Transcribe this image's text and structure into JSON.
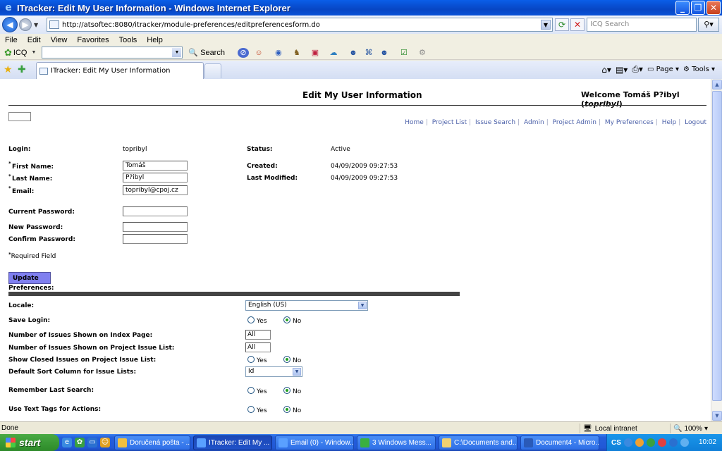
{
  "window": {
    "title": "ITracker: Edit My User Information - Windows Internet Explorer"
  },
  "address": {
    "url": "http://atsoftec:8080/itracker/module-preferences/editpreferencesform.do",
    "search_placeholder": "ICQ Search"
  },
  "menu": [
    "File",
    "Edit",
    "View",
    "Favorites",
    "Tools",
    "Help"
  ],
  "toolbar": {
    "icq_label": "ICQ",
    "search_label": "Search"
  },
  "tab": {
    "label": "ITracker: Edit My User Information"
  },
  "commandbar": {
    "page_label": "Page",
    "tools_label": "Tools"
  },
  "page": {
    "heading": "Edit My User Information",
    "welcome_prefix": "Welcome Tomáš P?ibyl (",
    "welcome_user": "topribyl",
    "welcome_suffix": ")",
    "nav": [
      "Home",
      "Project List",
      "Issue Search",
      "Admin",
      "Project Admin",
      "My Preferences",
      "Help",
      "Logout"
    ],
    "login_label": "Login:",
    "login_value": "topribyl",
    "status_label": "Status:",
    "status_value": "Active",
    "first_name_label": "First Name:",
    "first_name_value": "Tomáš",
    "last_name_label": "Last Name:",
    "last_name_value": "P?ibyl",
    "email_label": "Email:",
    "email_value": "topribyl@cpoj.cz",
    "created_label": "Created:",
    "created_value": "04/09/2009 09:27:53",
    "modified_label": "Last Modified:",
    "modified_value": "04/09/2009 09:27:53",
    "current_password_label": "Current Password:",
    "new_password_label": "New Password:",
    "confirm_password_label": "Confirm Password:",
    "required_note": "Required Field",
    "required_mark": "*",
    "update_label": "Update",
    "preferences_title": "Preferences:"
  },
  "prefs": {
    "locale_label": "Locale:",
    "locale_value": "English (US)",
    "save_login_label": "Save Login:",
    "issues_index_label": "Number of Issues Shown on Index Page:",
    "issues_index_value": "All",
    "issues_project_label": "Number of Issues Shown on Project Issue List:",
    "issues_project_value": "All",
    "show_closed_label": "Show Closed Issues on Project Issue List:",
    "sort_label": "Default Sort Column for Issue Lists:",
    "sort_value": "Id",
    "remember_label": "Remember Last Search:",
    "tags_label": "Use Text Tags for Actions:",
    "yes": "Yes",
    "no": "No"
  },
  "status": {
    "left": "Done",
    "zone": "Local intranet",
    "zoom": "100%"
  },
  "taskbar": {
    "start": "start",
    "tasks": [
      "Doručená pošta - ...",
      "ITracker: Edit My ...",
      "Email (0) - Window...",
      "3 Windows Mess...",
      "C:\\Documents and...",
      "Document4 - Micro..."
    ],
    "lang": "CS",
    "clock": "10:02"
  },
  "colors": {
    "update_button": "#7f7fef",
    "link": "#4a5fa8",
    "radio_dot": "#21a121"
  }
}
